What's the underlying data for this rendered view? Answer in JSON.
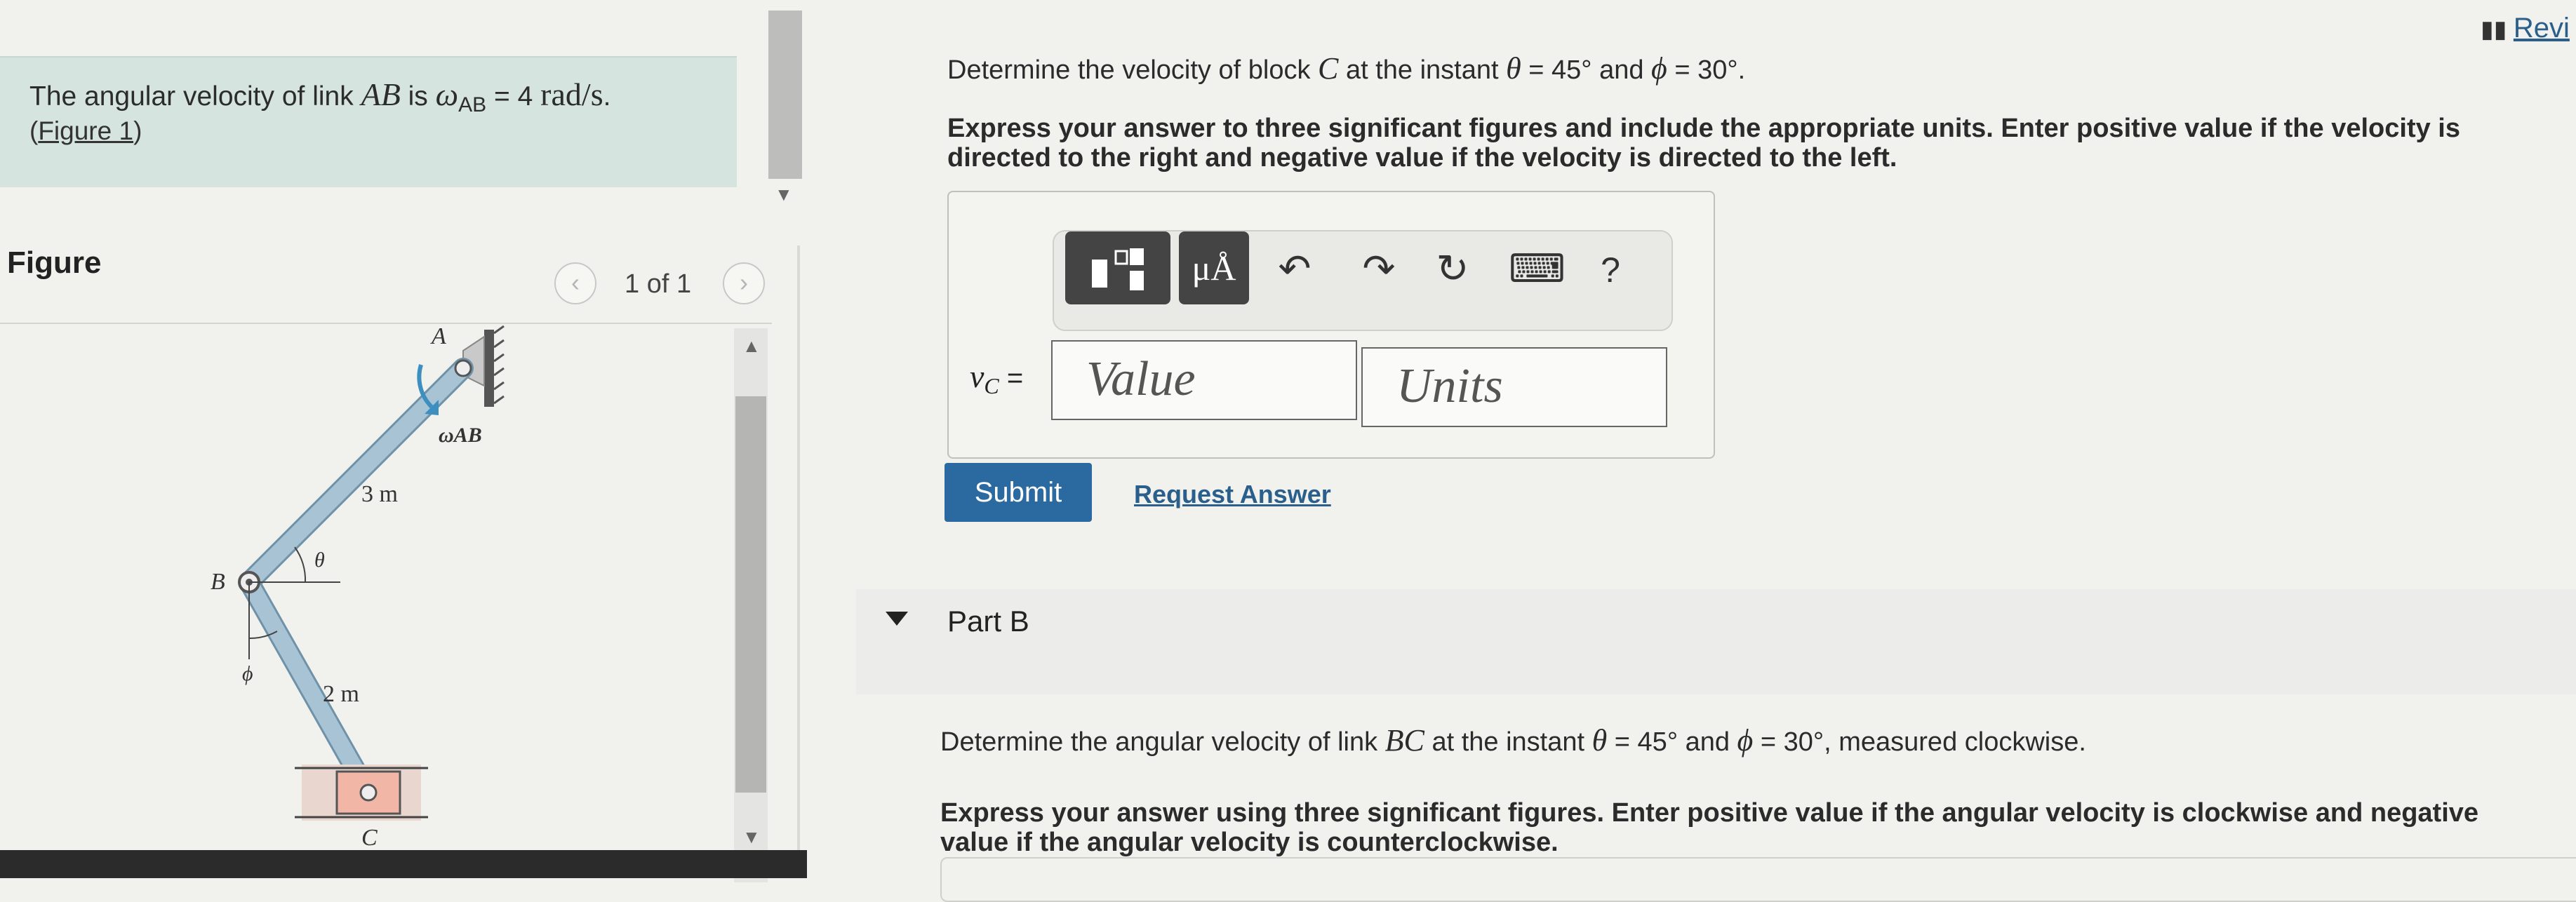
{
  "problem": {
    "intro_text": "The angular velocity of link",
    "link": "AB",
    "is_text": "is",
    "omega": "ω",
    "omega_sub": "AB",
    "equals_value": "= 4",
    "unit": "rad/s",
    "period": ".",
    "figure_link_open": "(",
    "figure_link": "Figure 1",
    "figure_link_close": ")"
  },
  "figure_panel": {
    "heading": "Figure",
    "pager": "1 of 1",
    "prev_icon": "‹",
    "next_icon": "›"
  },
  "diagram": {
    "label_A": "A",
    "label_B": "B",
    "label_C": "C",
    "omega_label": "ωAB",
    "length_AB": "3 m",
    "length_BC": "2 m",
    "angle_theta": "θ",
    "angle_phi": "ϕ",
    "colors": {
      "link": "#a8c4d4",
      "link_edge": "#6f92a8",
      "block": "#f2b6a6",
      "arrow": "#3c8fbf"
    }
  },
  "part_a": {
    "question_prefix": "Determine the velocity of block",
    "block": "C",
    "question_mid": "at the instant",
    "theta_eq": "θ",
    "theta_val": "= 45°",
    "and": "and",
    "phi_eq": "ϕ",
    "phi_val": "= 30°.",
    "instruction_line1": "Express your answer to three significant figures and include the appropriate units. Enter positive value if the velocity is",
    "instruction_line2": "directed to the right and negative value if the velocity is directed to the left.",
    "answer_label": "v",
    "answer_label_sub": "C",
    "answer_label_eq": "=",
    "value_placeholder": "Value",
    "units_placeholder": "Units",
    "submit_label": "Submit",
    "request_label": "Request Answer",
    "toolbar": {
      "templates_icon": "templates-icon",
      "units_symbol": "μÅ",
      "undo_icon": "↶",
      "redo_icon": "↷",
      "reset_icon": "↻",
      "keyboard_icon": "⌨",
      "help_label": "?"
    }
  },
  "part_b": {
    "title": "Part B",
    "question_prefix": "Determine the angular velocity of link",
    "link": "BC",
    "question_mid": "at the instant",
    "theta_eq": "θ",
    "theta_val": "= 45°",
    "and": "and",
    "phi_eq": "ϕ",
    "phi_val": "= 30°",
    "question_suffix": ", measured clockwise.",
    "instruction_line1": "Express your answer using three significant figures. Enter positive value if the angular velocity is clockwise and negative",
    "instruction_line2": "value if the angular velocity is counterclockwise."
  },
  "header": {
    "review_label": "Revi"
  }
}
